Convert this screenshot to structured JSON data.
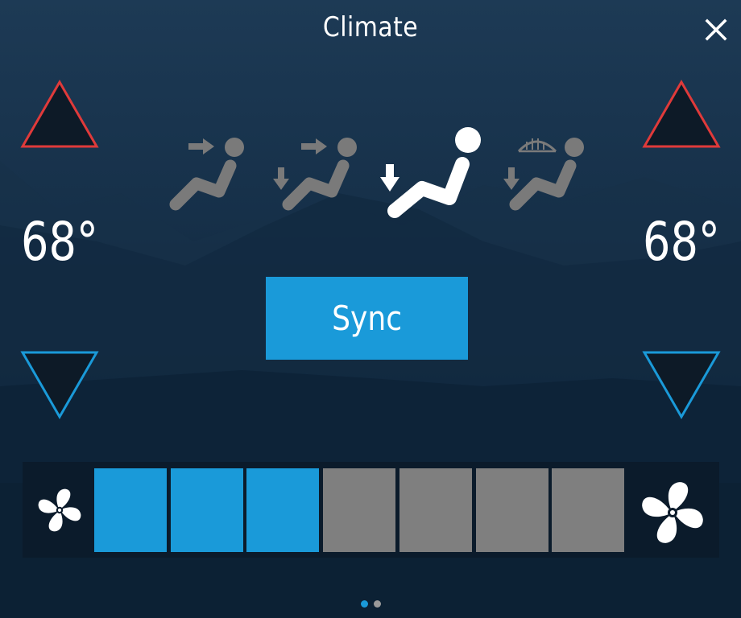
{
  "header": {
    "title": "Climate",
    "close_icon": "close-icon"
  },
  "left_zone": {
    "temperature": "68°",
    "up_icon": "triangle-up-icon",
    "down_icon": "triangle-down-icon"
  },
  "right_zone": {
    "temperature": "68°",
    "up_icon": "triangle-up-icon",
    "down_icon": "triangle-down-icon"
  },
  "airflow_modes": [
    {
      "icon": "airflow-face-icon",
      "selected": false
    },
    {
      "icon": "airflow-face-feet-icon",
      "selected": false
    },
    {
      "icon": "airflow-feet-icon",
      "selected": true
    },
    {
      "icon": "airflow-defrost-feet-icon",
      "selected": false
    }
  ],
  "sync": {
    "label": "Sync"
  },
  "fan": {
    "low_icon": "fan-low-icon",
    "high_icon": "fan-high-icon",
    "level": 3,
    "max_level": 7
  },
  "pager": {
    "current_page": 1,
    "page_count": 2
  },
  "colors": {
    "accent": "#1a9ad9",
    "increase": "#e03a3a",
    "decrease": "#1a9ad9",
    "inactive": "#7f7f7f",
    "selected_icon": "#ffffff"
  }
}
